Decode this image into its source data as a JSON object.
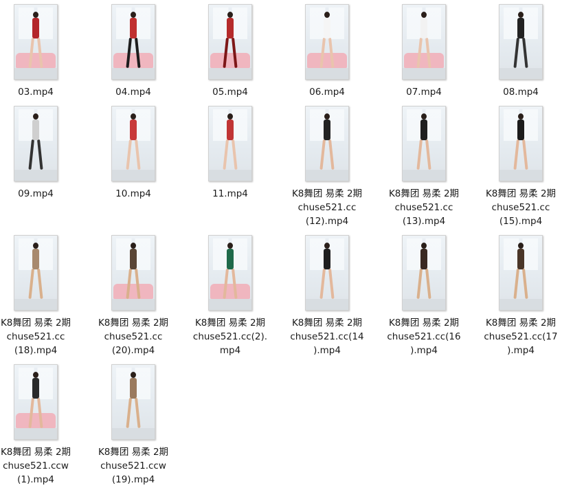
{
  "files": [
    {
      "name": "03.mp4",
      "thumbnail": {
        "outfit": "#b3262a",
        "legs": "#e9c4ad",
        "sofa": true
      }
    },
    {
      "name": "04.mp4",
      "thumbnail": {
        "outfit": "#c0302f",
        "legs": "#1d1d1d",
        "sofa": true
      }
    },
    {
      "name": "05.mp4",
      "thumbnail": {
        "outfit": "#b52b2b",
        "legs": "#7d1717",
        "sofa": true
      }
    },
    {
      "name": "06.mp4",
      "thumbnail": {
        "outfit": "#f5f5f5",
        "legs": "#e9c4ad",
        "sofa": true
      }
    },
    {
      "name": "07.mp4",
      "thumbnail": {
        "outfit": "#f2f2f2",
        "legs": "#e9c4ad",
        "sofa": true
      }
    },
    {
      "name": "08.mp4",
      "thumbnail": {
        "outfit": "#222222",
        "legs": "#333333",
        "sofa": false
      }
    },
    {
      "name": "09.mp4",
      "thumbnail": {
        "outfit": "#cfcfcf",
        "legs": "#333333",
        "sofa": false
      }
    },
    {
      "name": "10.mp4",
      "thumbnail": {
        "outfit": "#c83a3a",
        "legs": "#e9c4ad",
        "sofa": false
      }
    },
    {
      "name": "11.mp4",
      "thumbnail": {
        "outfit": "#c03535",
        "legs": "#e9c4ad",
        "sofa": false
      }
    },
    {
      "name": "K8舞团 易柔 2期\nchuse521.cc\n(12).mp4",
      "thumbnail": {
        "outfit": "#222222",
        "legs": "#e3b89c",
        "sofa": false
      }
    },
    {
      "name": "K8舞团 易柔 2期\nchuse521.cc\n(13).mp4",
      "thumbnail": {
        "outfit": "#1f1f1f",
        "legs": "#e3b89c",
        "sofa": false
      }
    },
    {
      "name": "K8舞团 易柔 2期\nchuse521.cc\n(15).mp4",
      "thumbnail": {
        "outfit": "#1c1c1c",
        "legs": "#e3b89c",
        "sofa": false
      }
    },
    {
      "name": "K8舞团 易柔 2期\nchuse521.cc\n(18).mp4",
      "thumbnail": {
        "outfit": "#a88a6e",
        "legs": "#d9b08c",
        "sofa": false
      }
    },
    {
      "name": "K8舞团 易柔 2期\nchuse521.cc\n(20).mp4",
      "thumbnail": {
        "outfit": "#5a4636",
        "legs": "#d9b08c",
        "sofa": true
      }
    },
    {
      "name": "K8舞团 易柔 2期\nchuse521.cc(2).\nmp4",
      "thumbnail": {
        "outfit": "#1f6a4a",
        "legs": "#e3b89c",
        "sofa": true
      }
    },
    {
      "name": "K8舞团 易柔 2期\nchuse521.cc(14\n).mp4",
      "thumbnail": {
        "outfit": "#1e1e1e",
        "legs": "#e3b89c",
        "sofa": false
      }
    },
    {
      "name": "K8舞团 易柔 2期\nchuse521.cc(16\n).mp4",
      "thumbnail": {
        "outfit": "#3a2a22",
        "legs": "#d9b08c",
        "sofa": false
      }
    },
    {
      "name": "K8舞团 易柔 2期\nchuse521.cc(17\n).mp4",
      "thumbnail": {
        "outfit": "#4a3628",
        "legs": "#d9b08c",
        "sofa": false
      }
    },
    {
      "name": "K8舞团 易柔 2期\nchuse521.ccw\n(1).mp4",
      "thumbnail": {
        "outfit": "#2a2a2a",
        "legs": "#e3b89c",
        "sofa": true
      }
    },
    {
      "name": "K8舞团 易柔 2期\nchuse521.ccw\n(19).mp4",
      "thumbnail": {
        "outfit": "#9a7a5e",
        "legs": "#d9b08c",
        "sofa": false
      }
    }
  ]
}
